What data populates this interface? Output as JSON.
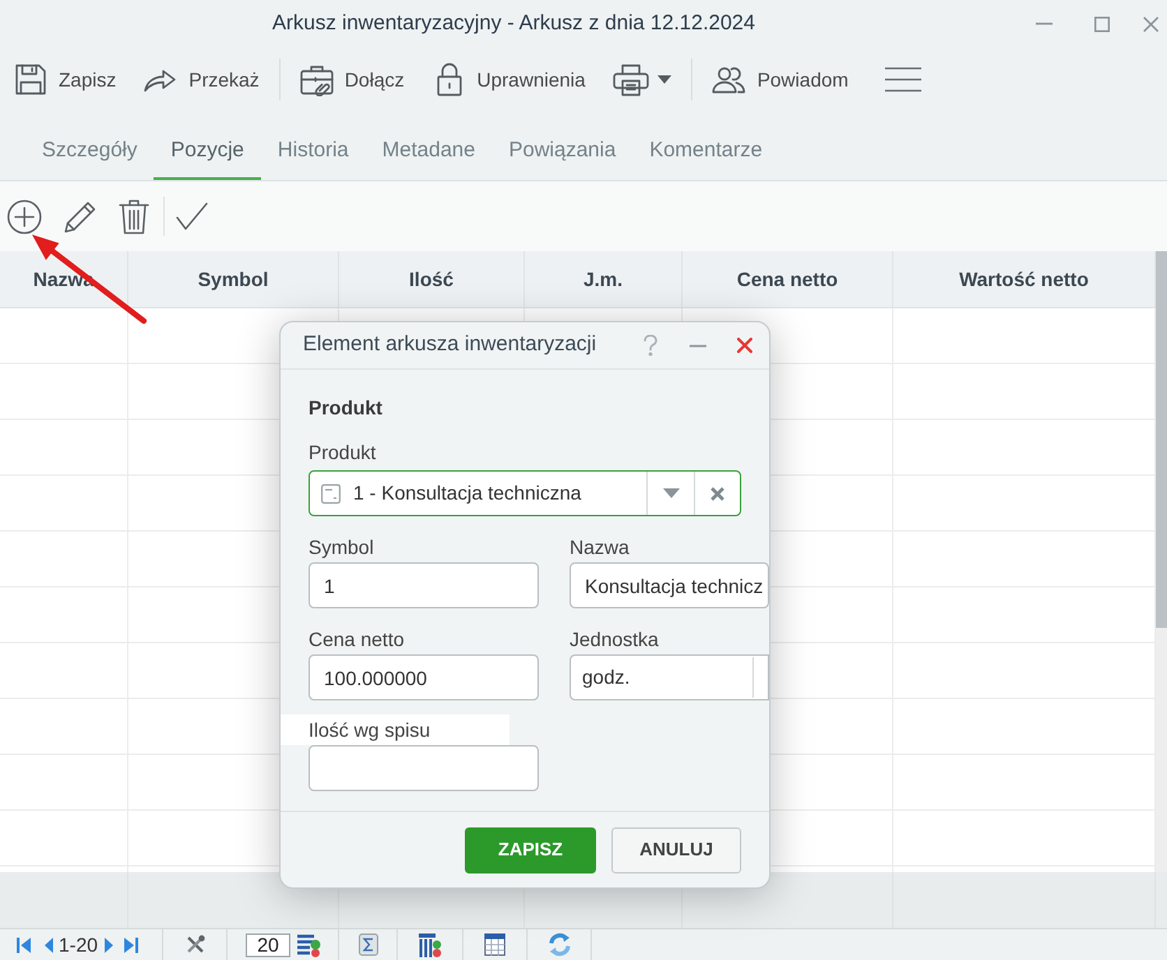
{
  "window": {
    "title": "Arkusz inwentaryzacyjny - Arkusz z dnia 12.12.2024"
  },
  "toolbar": [
    {
      "kind": "button",
      "label": "Zapisz"
    },
    {
      "kind": "button",
      "label": "Przekaż"
    },
    {
      "kind": "separator"
    },
    {
      "kind": "button",
      "label": "Dołącz"
    },
    {
      "kind": "button",
      "label": "Uprawnienia"
    },
    {
      "kind": "dropdown"
    },
    {
      "kind": "separator"
    },
    {
      "kind": "button",
      "label": "Powiadom"
    },
    {
      "kind": "menu"
    }
  ],
  "tabs": [
    {
      "label": "Szczegóły",
      "selected": false
    },
    {
      "label": "Pozycje",
      "selected": true
    },
    {
      "label": "Historia",
      "selected": false
    },
    {
      "label": "Metadane",
      "selected": false
    },
    {
      "label": "Powiązania",
      "selected": false
    },
    {
      "label": "Komentarze",
      "selected": false
    }
  ],
  "table": {
    "columns": [
      "Nazwa",
      "Symbol",
      "Ilość",
      "J.m.",
      "Cena netto",
      "Wartość netto"
    ]
  },
  "dialog": {
    "title": "Element arkusza inwentaryzacji",
    "section": "Produkt",
    "fields": [
      {
        "kind": "combo",
        "label": "Produkt",
        "value": "1 - Konsultacja techniczna",
        "focused": true,
        "highlighted": false
      },
      {
        "kind": "text",
        "label": "Symbol",
        "value": "1",
        "focused": false,
        "highlighted": false
      },
      {
        "kind": "text",
        "label": "Nazwa",
        "value": "Konsultacja technicz",
        "focused": false,
        "highlighted": false
      },
      {
        "kind": "text",
        "label": "Cena netto",
        "value": "100.000000",
        "focused": false,
        "highlighted": false
      },
      {
        "kind": "select",
        "label": "Jednostka",
        "value": "godz.",
        "focused": false,
        "highlighted": false
      },
      {
        "kind": "text",
        "label": "Ilość wg spisu",
        "focused": false,
        "highlighted": true
      }
    ],
    "buttons": [
      {
        "kind": "primary",
        "label": "ZAPISZ"
      },
      {
        "kind": "secondary",
        "label": "ANULUJ"
      }
    ]
  },
  "pager": {
    "range": "1-20",
    "page_size": "20"
  }
}
